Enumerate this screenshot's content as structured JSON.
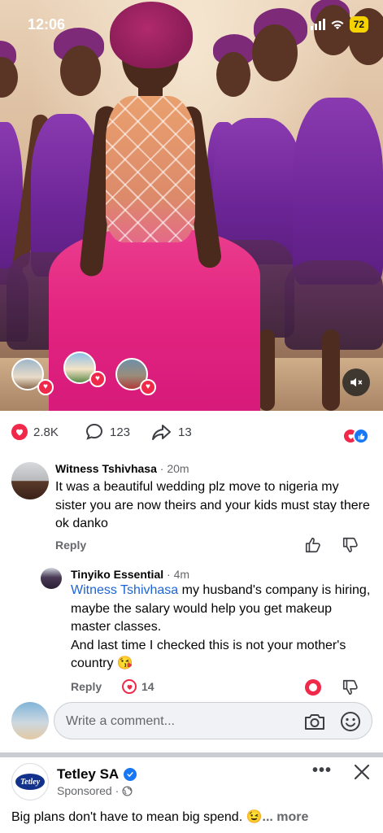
{
  "status_bar": {
    "time": "12:06",
    "battery": "72"
  },
  "post": {
    "reaction_count": "2.8K",
    "comment_count": "123",
    "share_count": "13"
  },
  "comments": [
    {
      "author": "Witness Tshivhasa",
      "time": " · 20m",
      "text": "It was a beautiful wedding plz move to nigeria my sister you are now theirs and your kids must stay there ok danko",
      "reply_label": "Reply"
    }
  ],
  "reply": {
    "author": "Tinyiko Essential",
    "time": " · 4m",
    "mention": "Witness Tshivhasa",
    "text_line1": " my husband's company is hiring, maybe the salary would help you get makeup master classes.",
    "text_line2": "And last time I checked this is not your mother's country 😘",
    "reply_label": "Reply",
    "heart_count": "14"
  },
  "composer": {
    "placeholder": "Write a comment..."
  },
  "sponsored": {
    "brand": "Tetley SA",
    "logo_text": "Tetley",
    "label": "Sponsored · ",
    "text": "Big plans don't have to mean big spend. 😉",
    "more": "... more"
  },
  "colors": {
    "love": "#f02849",
    "like": "#1877f2",
    "mention": "#1c64d6",
    "muted": "#65676b"
  }
}
